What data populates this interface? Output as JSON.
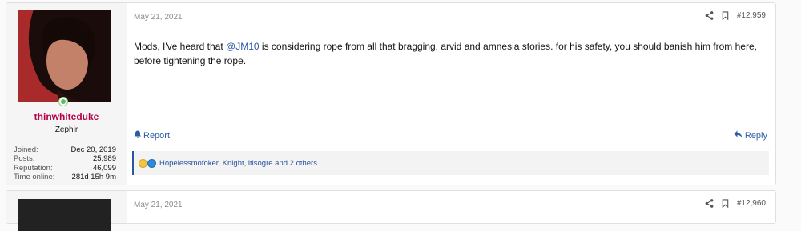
{
  "post": {
    "date": "May 21, 2021",
    "number": "#12,959",
    "message": {
      "part1": "Mods, I've heard that ",
      "mention": "@JM10",
      "part2": " is considering rope from all that bragging, arvid and amnesia stories. for his safety, you should banish him from here, before tightening the rope."
    },
    "report_label": "Report",
    "reply_label": "Reply",
    "reactions_text": "Hopelessmofoker, Knight, itisogre and 2 others",
    "colors": {
      "accent": "#2a55a0",
      "username": "#b5004a",
      "online": "#61bb5e"
    }
  },
  "user": {
    "name": "thinwhiteduke",
    "title": "Zephir",
    "stats": [
      {
        "label": "Joined:",
        "value": "Dec 20, 2019"
      },
      {
        "label": "Posts:",
        "value": "25,989"
      },
      {
        "label": "Reputation:",
        "value": "46,099"
      },
      {
        "label": "Time online:",
        "value": "281d 15h 9m"
      }
    ]
  },
  "next_post": {
    "date": "May 21, 2021",
    "number": "#12,960"
  },
  "icons": [
    "share-icon",
    "bookmark-icon",
    "report-icon",
    "reply-icon",
    "online-icon",
    "laugh-reaction-icon",
    "like-reaction-icon"
  ]
}
